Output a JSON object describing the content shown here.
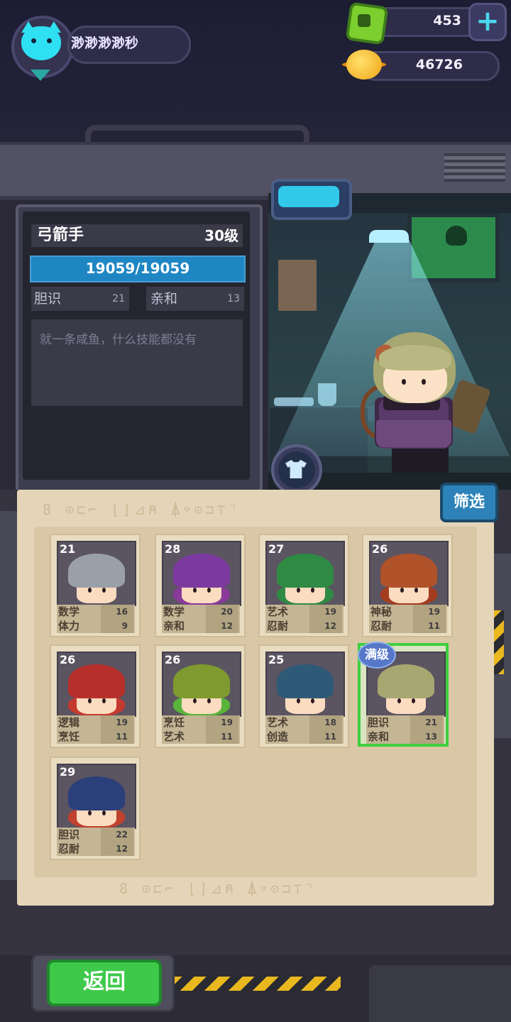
{
  "player": {
    "name": "渺渺渺渺秒",
    "avatar_icon": "cat-face-icon"
  },
  "currencies": {
    "gems": {
      "value": "453",
      "icon": "green-gem-icon"
    },
    "coins": {
      "value": "46726",
      "icon": "gold-coin-icon"
    },
    "add_icon": "plus-icon"
  },
  "selected_hero": {
    "class_name": "弓箭手",
    "level": "30级",
    "hp": "19059/19059",
    "attributes": [
      {
        "name": "胆识",
        "value": "21"
      },
      {
        "name": "亲和",
        "value": "13"
      }
    ],
    "skill_desc": "就一条咸鱼，什么技能都没有"
  },
  "filter_label": "筛选",
  "maxlevel_label": "满级",
  "runes_text": "8 ⊙⊏⌐ ⌊⌋⊿⍝ ⍋⌔⊙⊐⊤⌝",
  "heroes": [
    {
      "level": "21",
      "stats": [
        {
          "name": "数学",
          "value": "16"
        },
        {
          "name": "体力",
          "value": "9"
        }
      ],
      "hat": "knight-helmet",
      "selected": false
    },
    {
      "level": "28",
      "stats": [
        {
          "name": "数学",
          "value": "20"
        },
        {
          "name": "亲和",
          "value": "12"
        }
      ],
      "hat": "purple-wizard-hat",
      "selected": false
    },
    {
      "level": "27",
      "stats": [
        {
          "name": "艺术",
          "value": "19"
        },
        {
          "name": "忍耐",
          "value": "12"
        }
      ],
      "hat": "green-hood",
      "selected": false
    },
    {
      "level": "26",
      "stats": [
        {
          "name": "神秘",
          "value": "19"
        },
        {
          "name": "忍耐",
          "value": "11"
        }
      ],
      "hat": "brown-hood",
      "selected": false
    },
    {
      "level": "26",
      "stats": [
        {
          "name": "逻辑",
          "value": "19"
        },
        {
          "name": "烹饪",
          "value": "11"
        }
      ],
      "hat": "red-hood",
      "selected": false
    },
    {
      "level": "26",
      "stats": [
        {
          "name": "烹饪",
          "value": "19"
        },
        {
          "name": "艺术",
          "value": "11"
        }
      ],
      "hat": "olive-hood",
      "selected": false
    },
    {
      "level": "25",
      "stats": [
        {
          "name": "艺术",
          "value": "18"
        },
        {
          "name": "创造",
          "value": "11"
        }
      ],
      "hat": "antler-headband",
      "selected": false
    },
    {
      "level": "",
      "stats": [
        {
          "name": "胆识",
          "value": "21"
        },
        {
          "name": "亲和",
          "value": "13"
        }
      ],
      "hat": "archer-elf",
      "selected": true
    },
    {
      "level": "29",
      "stats": [
        {
          "name": "胆识",
          "value": "22"
        },
        {
          "name": "忍耐",
          "value": "12"
        }
      ],
      "hat": "feather-headband",
      "selected": false
    }
  ],
  "back_label": "返回",
  "colors": {
    "accent_cyan": "#2ee0f2",
    "hp_blue": "#1f86c4",
    "select_green": "#3ecf3e",
    "back_green": "#3ec94a"
  }
}
